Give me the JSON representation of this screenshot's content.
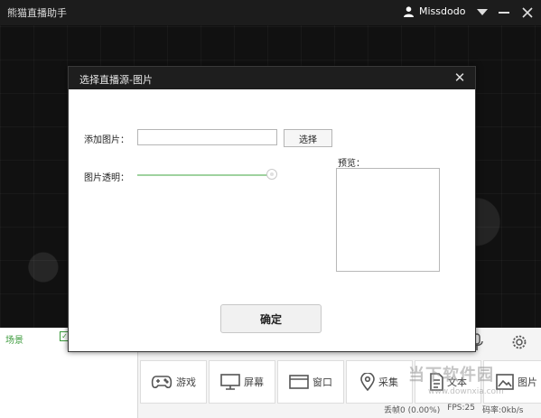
{
  "app": {
    "title": "熊猫直播助手",
    "username": "Missdodo"
  },
  "bottom": {
    "scene_label": "场景",
    "tools": [
      {
        "label": "游戏",
        "icon": "gamepad-icon"
      },
      {
        "label": "屏幕",
        "icon": "monitor-icon"
      },
      {
        "label": "窗口",
        "icon": "window-icon"
      },
      {
        "label": "采集",
        "icon": "location-pin-icon"
      },
      {
        "label": "文本",
        "icon": "text-icon"
      },
      {
        "label": "图片",
        "icon": "image-icon"
      }
    ],
    "status": {
      "drop": "丢帧0 (0.00%)",
      "fps": "FPS:25",
      "bitrate": "码率:0kb/s"
    },
    "watermark": "当下软件园",
    "watermark_url": "www.downxia.com"
  },
  "dialog": {
    "title": "选择直播源-图片",
    "add_image_label": "添加图片：",
    "path_value": "",
    "choose_button": "选择",
    "transparency_label": "图片透明：",
    "transparency_value": 1.0,
    "preview_label": "预览：",
    "confirm_button": "确定"
  },
  "colors": {
    "accent": "#3c9b3c",
    "titlebar": "#1c1c1c"
  }
}
